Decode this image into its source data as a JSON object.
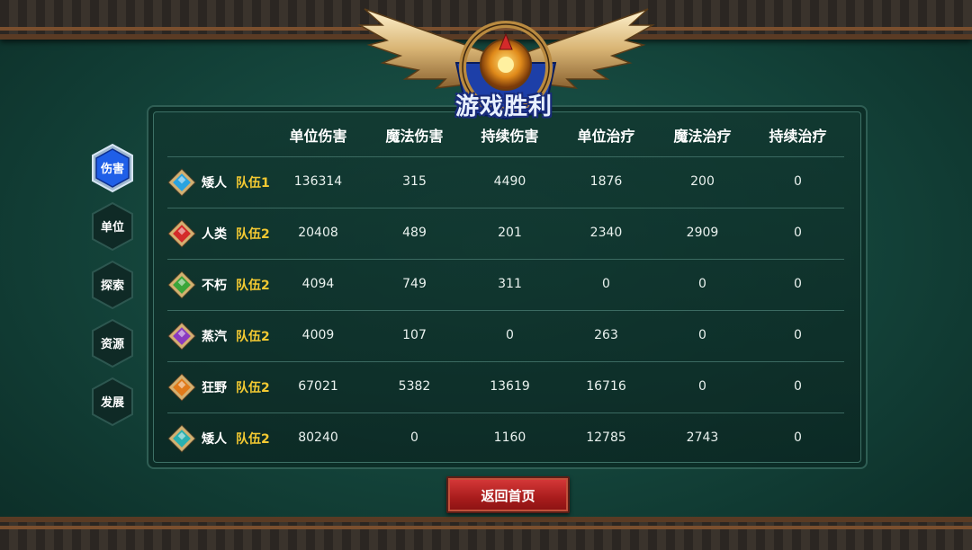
{
  "title": "游戏胜利",
  "columns": [
    "单位伤害",
    "魔法伤害",
    "持续伤害",
    "单位治疗",
    "魔法治疗",
    "持续治疗"
  ],
  "tabs": [
    {
      "label": "伤害",
      "active": true
    },
    {
      "label": "单位",
      "active": false
    },
    {
      "label": "探索",
      "active": false
    },
    {
      "label": "资源",
      "active": false
    },
    {
      "label": "发展",
      "active": false
    }
  ],
  "rows": [
    {
      "race": "矮人",
      "team": "队伍1",
      "gem_color": "#2aa3e0",
      "values": [
        "136314",
        "315",
        "4490",
        "1876",
        "200",
        "0"
      ]
    },
    {
      "race": "人类",
      "team": "队伍2",
      "gem_color": "#d42a2a",
      "values": [
        "20408",
        "489",
        "201",
        "2340",
        "2909",
        "0"
      ]
    },
    {
      "race": "不朽",
      "team": "队伍2",
      "gem_color": "#3aa53a",
      "values": [
        "4094",
        "749",
        "311",
        "0",
        "0",
        "0"
      ]
    },
    {
      "race": "蒸汽",
      "team": "队伍2",
      "gem_color": "#8a3ac0",
      "values": [
        "4009",
        "107",
        "0",
        "263",
        "0",
        "0"
      ]
    },
    {
      "race": "狂野",
      "team": "队伍2",
      "gem_color": "#e07a1a",
      "values": [
        "67021",
        "5382",
        "13619",
        "16716",
        "0",
        "0"
      ]
    },
    {
      "race": "矮人",
      "team": "队伍2",
      "gem_color": "#2ab0b0",
      "values": [
        "80240",
        "0",
        "1160",
        "12785",
        "2743",
        "0"
      ]
    }
  ],
  "home_button": "返回首页"
}
